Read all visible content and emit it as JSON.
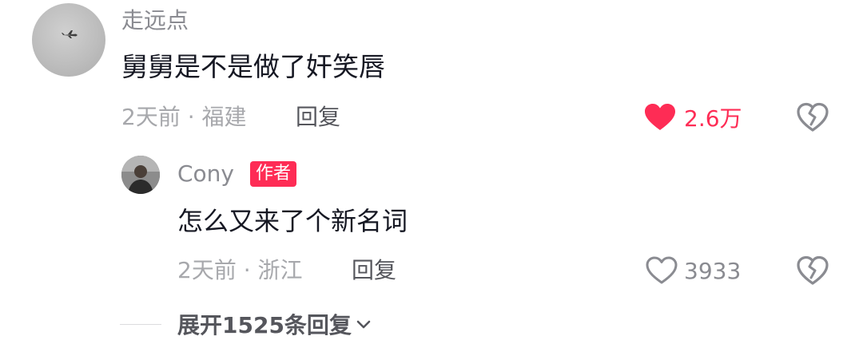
{
  "comment": {
    "username": "走远点",
    "text": "舅舅是不是做了奸笑唇",
    "meta": "2天前 · 福建",
    "reply_label": "回复",
    "likes": "2.6万",
    "liked": true,
    "avatar_icon": "airplane-in-sky-photo"
  },
  "reply": {
    "username": "Cony",
    "badge": "作者",
    "text": "怎么又来了个新名词",
    "meta": "2天前 · 浙江",
    "reply_label": "回复",
    "likes": "3933",
    "liked": false,
    "avatar_icon": "person-photo"
  },
  "expand": {
    "label": "展开1525条回复",
    "icon": "chevron-down-icon"
  },
  "colors": {
    "accent": "#fe2c55",
    "primary_text": "#161823",
    "secondary_text": "#8a8b91",
    "meta_text": "#a7a8ac"
  }
}
